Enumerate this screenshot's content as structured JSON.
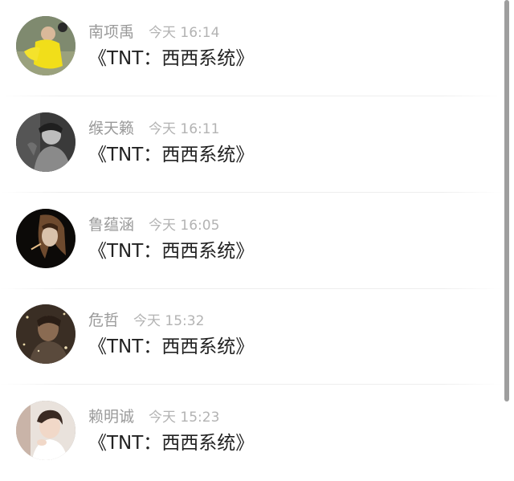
{
  "comments": [
    {
      "name": "南项禹",
      "time": "今天 16:14",
      "message": "《TNT：西西系统》",
      "avatar": "avatar-yellow-costume"
    },
    {
      "name": "缑天籁",
      "time": "今天 16:11",
      "message": "《TNT：西西系统》",
      "avatar": "avatar-monochrome"
    },
    {
      "name": "鲁蕴涵",
      "time": "今天 16:05",
      "message": "《TNT：西西系统》",
      "avatar": "avatar-dark-portrait"
    },
    {
      "name": "危哲",
      "time": "今天 15:32",
      "message": "《TNT：西西系统》",
      "avatar": "avatar-sparkle-portrait"
    },
    {
      "name": "赖明诚",
      "time": "今天 15:23",
      "message": "《TNT：西西系统》",
      "avatar": "avatar-soft-portrait"
    }
  ],
  "colors": {
    "name": "#9a9a9a",
    "time": "#b3b3b3",
    "message": "#222222",
    "divider": "#eeeeee",
    "scrollbar": "#9e9e9e"
  }
}
